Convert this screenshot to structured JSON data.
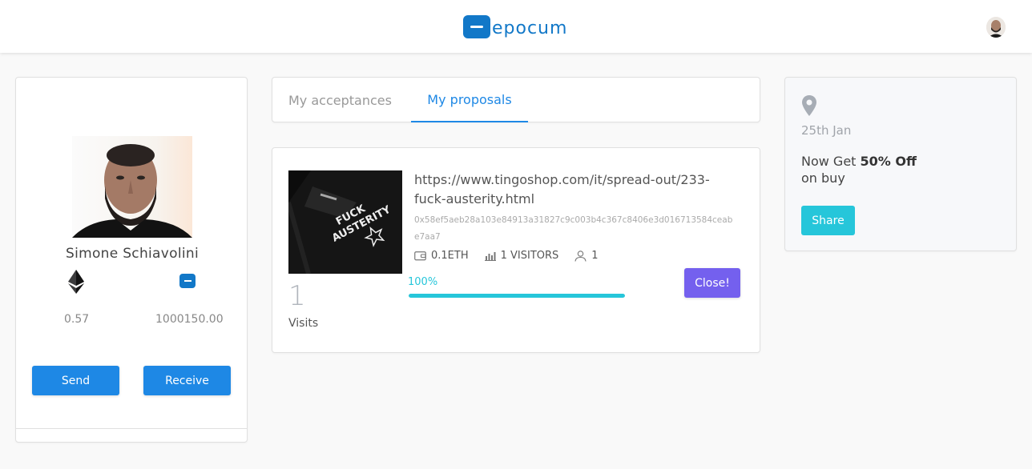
{
  "header": {
    "logo_text": "epocum"
  },
  "profile": {
    "name": "Simone Schiavolini",
    "eth_balance": "0.57",
    "epocum_balance": "1000150.00",
    "send_label": "Send",
    "receive_label": "Receive"
  },
  "tabs": [
    {
      "label": "My acceptances",
      "active": false
    },
    {
      "label": "My proposals",
      "active": true
    }
  ],
  "proposal": {
    "url": "https://www.tingoshop.com/it/spread-out/233-fuck-austerity.html",
    "hash": "0x58ef5aeb28a103e84913a31827c9c003b4c367c8406e3d016713584ceabe7aa7",
    "eth_amount": "0.1ETH",
    "visitors": "1 VISITORS",
    "users": "1",
    "visits_count": "1",
    "visits_label": "Visits",
    "progress_text": "100%",
    "progress": 1.0,
    "close_label": "Close!",
    "image_caption": "FUCK AUSTERITY"
  },
  "promo": {
    "date": "25th Jan",
    "text_prefix": "Now Get ",
    "text_bold": "50% Off",
    "text_suffix": "on buy",
    "share_label": "Share"
  },
  "colors": {
    "brand": "#1278c8",
    "primary": "#1e88e5",
    "accent_cyan": "#26c6da",
    "accent_purple": "#7460ee"
  }
}
